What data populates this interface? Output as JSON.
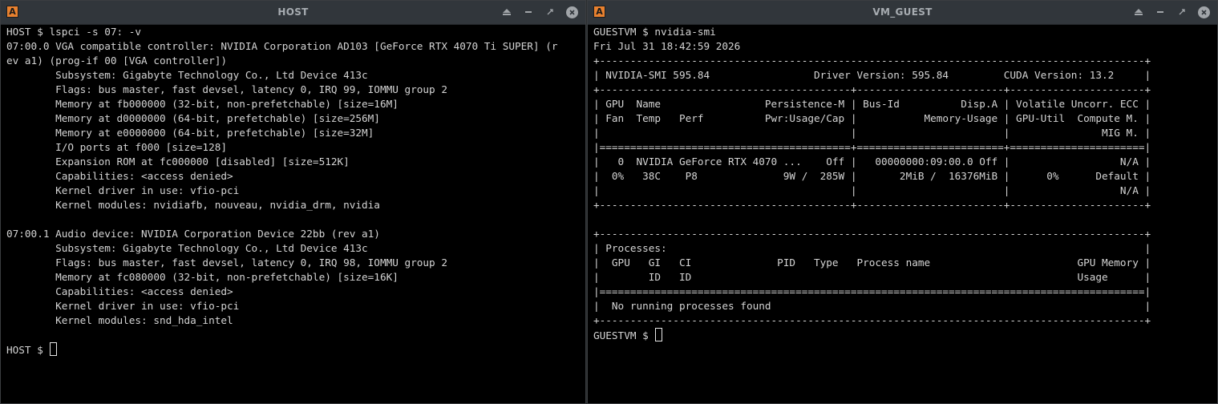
{
  "host": {
    "title": "HOST",
    "lines": [
      "HOST $ lspci -s 07: -v",
      "07:00.0 VGA compatible controller: NVIDIA Corporation AD103 [GeForce RTX 4070 Ti SUPER] (r",
      "ev a1) (prog-if 00 [VGA controller])",
      "        Subsystem: Gigabyte Technology Co., Ltd Device 413c",
      "        Flags: bus master, fast devsel, latency 0, IRQ 99, IOMMU group 2",
      "        Memory at fb000000 (32-bit, non-prefetchable) [size=16M]",
      "        Memory at d0000000 (64-bit, prefetchable) [size=256M]",
      "        Memory at e0000000 (64-bit, prefetchable) [size=32M]",
      "        I/O ports at f000 [size=128]",
      "        Expansion ROM at fc000000 [disabled] [size=512K]",
      "        Capabilities: <access denied>",
      "        Kernel driver in use: vfio-pci",
      "        Kernel modules: nvidiafb, nouveau, nvidia_drm, nvidia",
      "",
      "07:00.1 Audio device: NVIDIA Corporation Device 22bb (rev a1)",
      "        Subsystem: Gigabyte Technology Co., Ltd Device 413c",
      "        Flags: bus master, fast devsel, latency 0, IRQ 98, IOMMU group 2",
      "        Memory at fc080000 (32-bit, non-prefetchable) [size=16K]",
      "        Capabilities: <access denied>",
      "        Kernel driver in use: vfio-pci",
      "        Kernel modules: snd_hda_intel",
      ""
    ],
    "prompt": "HOST $ "
  },
  "guest": {
    "title": "VM_GUEST",
    "lines": [
      "GUESTVM $ nvidia-smi",
      "Fri Jul 31 18:42:59 2026",
      "+-----------------------------------------------------------------------------------------+",
      "| NVIDIA-SMI 595.84                 Driver Version: 595.84         CUDA Version: 13.2     |",
      "+-----------------------------------------+------------------------+----------------------+",
      "| GPU  Name                 Persistence-M | Bus-Id          Disp.A | Volatile Uncorr. ECC |",
      "| Fan  Temp   Perf          Pwr:Usage/Cap |           Memory-Usage | GPU-Util  Compute M. |",
      "|                                         |                        |               MIG M. |",
      "|=========================================+========================+======================|",
      "|   0  NVIDIA GeForce RTX 4070 ...    Off |   00000000:09:00.0 Off |                  N/A |",
      "|  0%   38C    P8              9W /  285W |       2MiB /  16376MiB |      0%      Default |",
      "|                                         |                        |                  N/A |",
      "+-----------------------------------------+------------------------+----------------------+",
      "",
      "+-----------------------------------------------------------------------------------------+",
      "| Processes:                                                                              |",
      "|  GPU   GI   CI              PID   Type   Process name                        GPU Memory |",
      "|        ID   ID                                                               Usage      |",
      "|=========================================================================================|",
      "|  No running processes found                                                             |",
      "+-----------------------------------------------------------------------------------------+"
    ],
    "prompt": "GUESTVM $ "
  }
}
